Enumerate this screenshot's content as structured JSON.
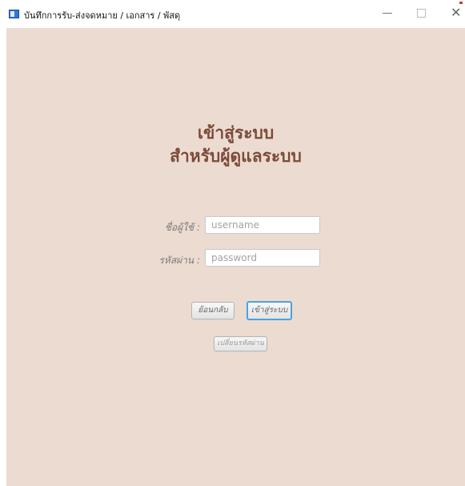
{
  "window": {
    "title": "บันทึกการรับ-ส่งจดหมาย / เอกสาร / พัสดุ",
    "controls": {
      "minimize": "—",
      "maximize": "☐",
      "close": "✕"
    }
  },
  "heading": {
    "line1": "เข้าสู่ระบบ",
    "line2": "สำหรับผู้ดูแลระบบ"
  },
  "form": {
    "username_label": "ชื่อผู้ใช้ :",
    "username_placeholder": "username",
    "username_value": "",
    "password_label": "รหัสผ่าน :",
    "password_placeholder": "password",
    "password_value": ""
  },
  "buttons": {
    "back": "ย้อนกลับ",
    "login": "เข้าสู่ระบบ",
    "change_password": "เปลี่ยนรหัสผ่าน"
  },
  "colors": {
    "background": "#ecdbd0",
    "heading": "#7b4a39",
    "focus_border": "#4aa3df",
    "app_icon": "#2b7bd8"
  },
  "icons": {
    "app": "app-window-icon",
    "minimize": "minimize-icon",
    "maximize": "maximize-icon",
    "close": "close-icon"
  }
}
